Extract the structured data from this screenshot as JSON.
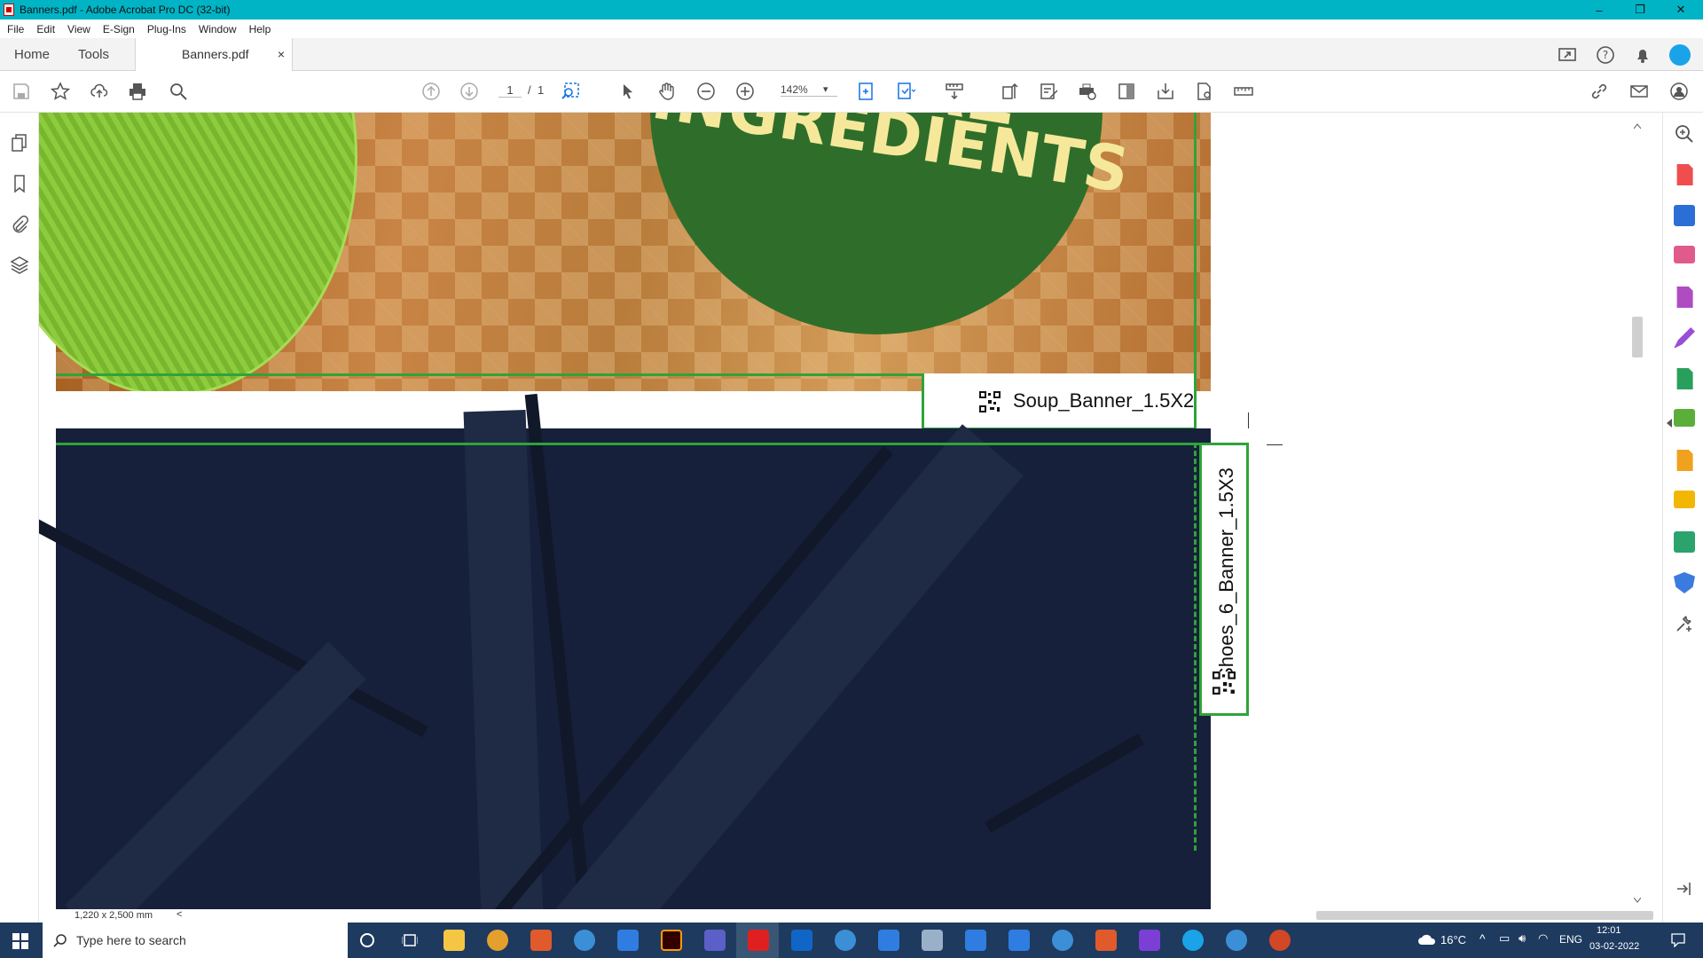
{
  "window": {
    "title": "Banners.pdf - Adobe Acrobat Pro DC (32-bit)",
    "controls": [
      "–",
      "❐",
      "✕"
    ]
  },
  "menu": [
    "File",
    "Edit",
    "View",
    "E-Sign",
    "Plug-Ins",
    "Window",
    "Help"
  ],
  "tabs": {
    "home": "Home",
    "tools": "Tools",
    "document": "Banners.pdf",
    "close": "×"
  },
  "toolbar": {
    "page_current": "1",
    "page_sep": "/",
    "page_total": "1",
    "zoom": "142%",
    "zoom_caret": "▾"
  },
  "document": {
    "soup_badge_top": "TURAL",
    "soup_badge_text": "INGREDIENTS",
    "soup_label": "Soup_Banner_1.5X2",
    "shoes_label": "Shoes_6_Banner_1.5X3"
  },
  "statusbar": {
    "page_size": "1,220 x 2,500 mm",
    "left_arrow": "<"
  },
  "taskbar": {
    "search_placeholder": "Type here to search",
    "weather": "16°C",
    "lang": "ENG",
    "time": "12:01",
    "date": "03-02-2022"
  },
  "colors": {
    "titlebar": "#00b4c5",
    "accent_blue": "#1473e6",
    "trim_green": "#2fa33a",
    "shoes_bg": "#17203a",
    "badge_green": "#2f6e2a",
    "badge_text": "#f6e89a",
    "taskbar": "#1e3a5f"
  }
}
